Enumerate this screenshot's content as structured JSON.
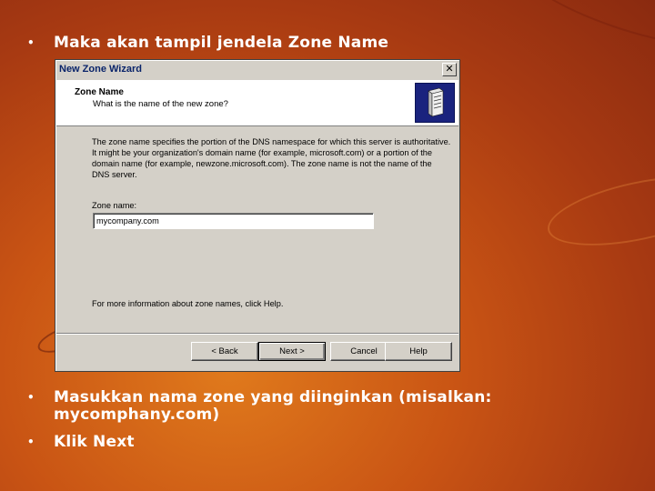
{
  "slide": {
    "bullets": [
      "Maka akan tampil jendela Zone Name",
      "Masukkan nama zone yang diinginkan (misalkan: mycomphany.com)",
      "Klik Next"
    ],
    "bullet_glyph": "•",
    "bullet_2_line1": "Masukkan nama zone yang diinginkan (misalkan:",
    "bullet_2_line2": "mycomphany.com)"
  },
  "dialog": {
    "title": "New Zone Wizard",
    "close_glyph": "✕",
    "header_title": "Zone Name",
    "header_subtitle": "What is the name of the new zone?",
    "header_icon": "dns-server-icon",
    "description": "The zone name specifies the portion of the DNS namespace for which this server is authoritative. It might be your organization's domain name (for example, microsoft.com) or a portion of the domain name (for example, newzone.microsoft.com). The zone name is not the name of the DNS server.",
    "zone_name_label": "Zone name:",
    "zone_name_value": "mycompany.com",
    "more_info": "For more information about zone names, click Help.",
    "buttons": {
      "back": "< Back",
      "next": "Next >",
      "cancel": "Cancel",
      "help": "Help"
    }
  },
  "colors": {
    "background": "#c95414",
    "dialog_face": "#d4d0c8",
    "header_icon_bg": "#1a237e",
    "title_text": "#0a246a",
    "slide_text": "#ffffff"
  }
}
